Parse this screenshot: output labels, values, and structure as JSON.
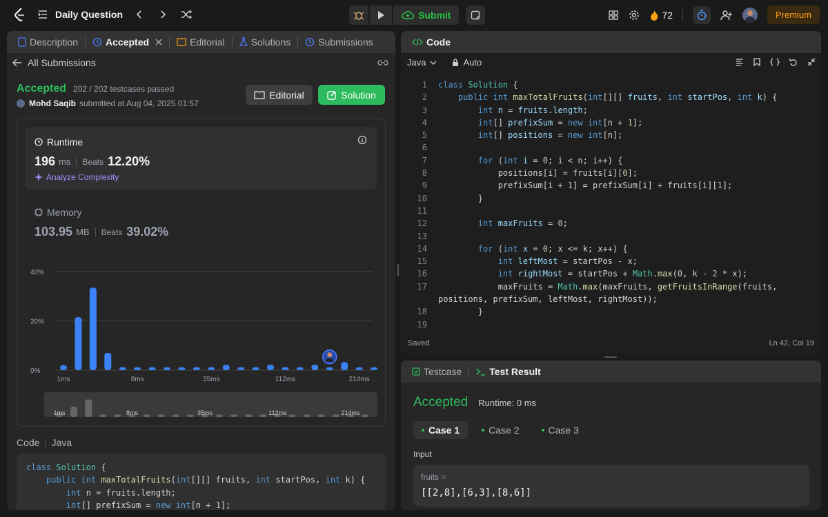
{
  "topbar": {
    "problem_list_label": "Daily Question",
    "submit_label": "Submit",
    "streak_count": "72",
    "premium_label": "Premium"
  },
  "left_panel": {
    "tabs": [
      {
        "label": "Description",
        "icon": "description-icon"
      },
      {
        "label": "Accepted",
        "icon": "history-icon",
        "active": true
      },
      {
        "label": "Editorial",
        "icon": "book-icon"
      },
      {
        "label": "Solutions",
        "icon": "flask-icon"
      },
      {
        "label": "Submissions",
        "icon": "history-icon"
      }
    ],
    "back_label": "All Submissions",
    "status": "Accepted",
    "testcases": "202 / 202 testcases passed",
    "author": "Mohd Saqib",
    "submitted_at": "submitted at Aug 04, 2025 01:57",
    "editorial_button": "Editorial",
    "solution_button": "Solution",
    "runtime": {
      "title": "Runtime",
      "value": "196",
      "unit": "ms",
      "beats_label": "Beats",
      "beats_value": "12.20%",
      "analyze_label": "Analyze Complexity"
    },
    "memory": {
      "title": "Memory",
      "value": "103.95",
      "unit": "MB",
      "beats_label": "Beats",
      "beats_value": "39.02%"
    },
    "code_label": "Code",
    "lang_label": "Java",
    "code_preview": [
      "class Solution {",
      "    public int maxTotalFruits(int[][] fruits, int startPos, int k) {",
      "        int n = fruits.length;",
      "        int[] prefixSum = new int[n + 1];"
    ]
  },
  "chart_data": {
    "type": "bar",
    "ylabels": [
      "40%",
      "20%",
      "0%"
    ],
    "ylim": [
      0,
      40
    ],
    "xticks": [
      "1ms",
      "8ms",
      "35ms",
      "112ms",
      "214ms"
    ],
    "values": [
      2,
      21.5,
      33.5,
      7,
      1.2,
      1.2,
      1.2,
      1.2,
      1.2,
      1.2,
      1.2,
      2.2,
      1.2,
      1.2,
      2.2,
      1.2,
      1.2,
      2.2,
      1.2,
      3.3,
      1.2,
      1.2
    ],
    "highlight_index": 18,
    "bar_color": "#3b82f6",
    "mini_heights": [
      0.2,
      0.5,
      0.85,
      0.12,
      0.12,
      0.12,
      0.12,
      0.12,
      0.12,
      0.12,
      0.12,
      0.12,
      0.12,
      0.12,
      0.12,
      0.12,
      0.12,
      0.12,
      0.12,
      0.12,
      0.12,
      0.12
    ]
  },
  "right_panel": {
    "code_tab": "Code",
    "lang": "Java",
    "mode": "Auto",
    "saved": "Saved",
    "cursor": "Ln 42, Col 19",
    "line_numbers": [
      "1",
      "2",
      "3",
      "4",
      "5",
      "6",
      "7",
      "8",
      "9",
      "10",
      "11",
      "12",
      "13",
      "14",
      "15",
      "16",
      "17",
      "",
      "18",
      "19"
    ]
  },
  "result_panel": {
    "testcase_tab": "Testcase",
    "result_tab": "Test Result",
    "status": "Accepted",
    "runtime": "Runtime: 0 ms",
    "cases": [
      "Case 1",
      "Case 2",
      "Case 3"
    ],
    "input_label": "Input",
    "param_name": "fruits =",
    "param_value": "[[2,8],[6,3],[8,6]]"
  }
}
